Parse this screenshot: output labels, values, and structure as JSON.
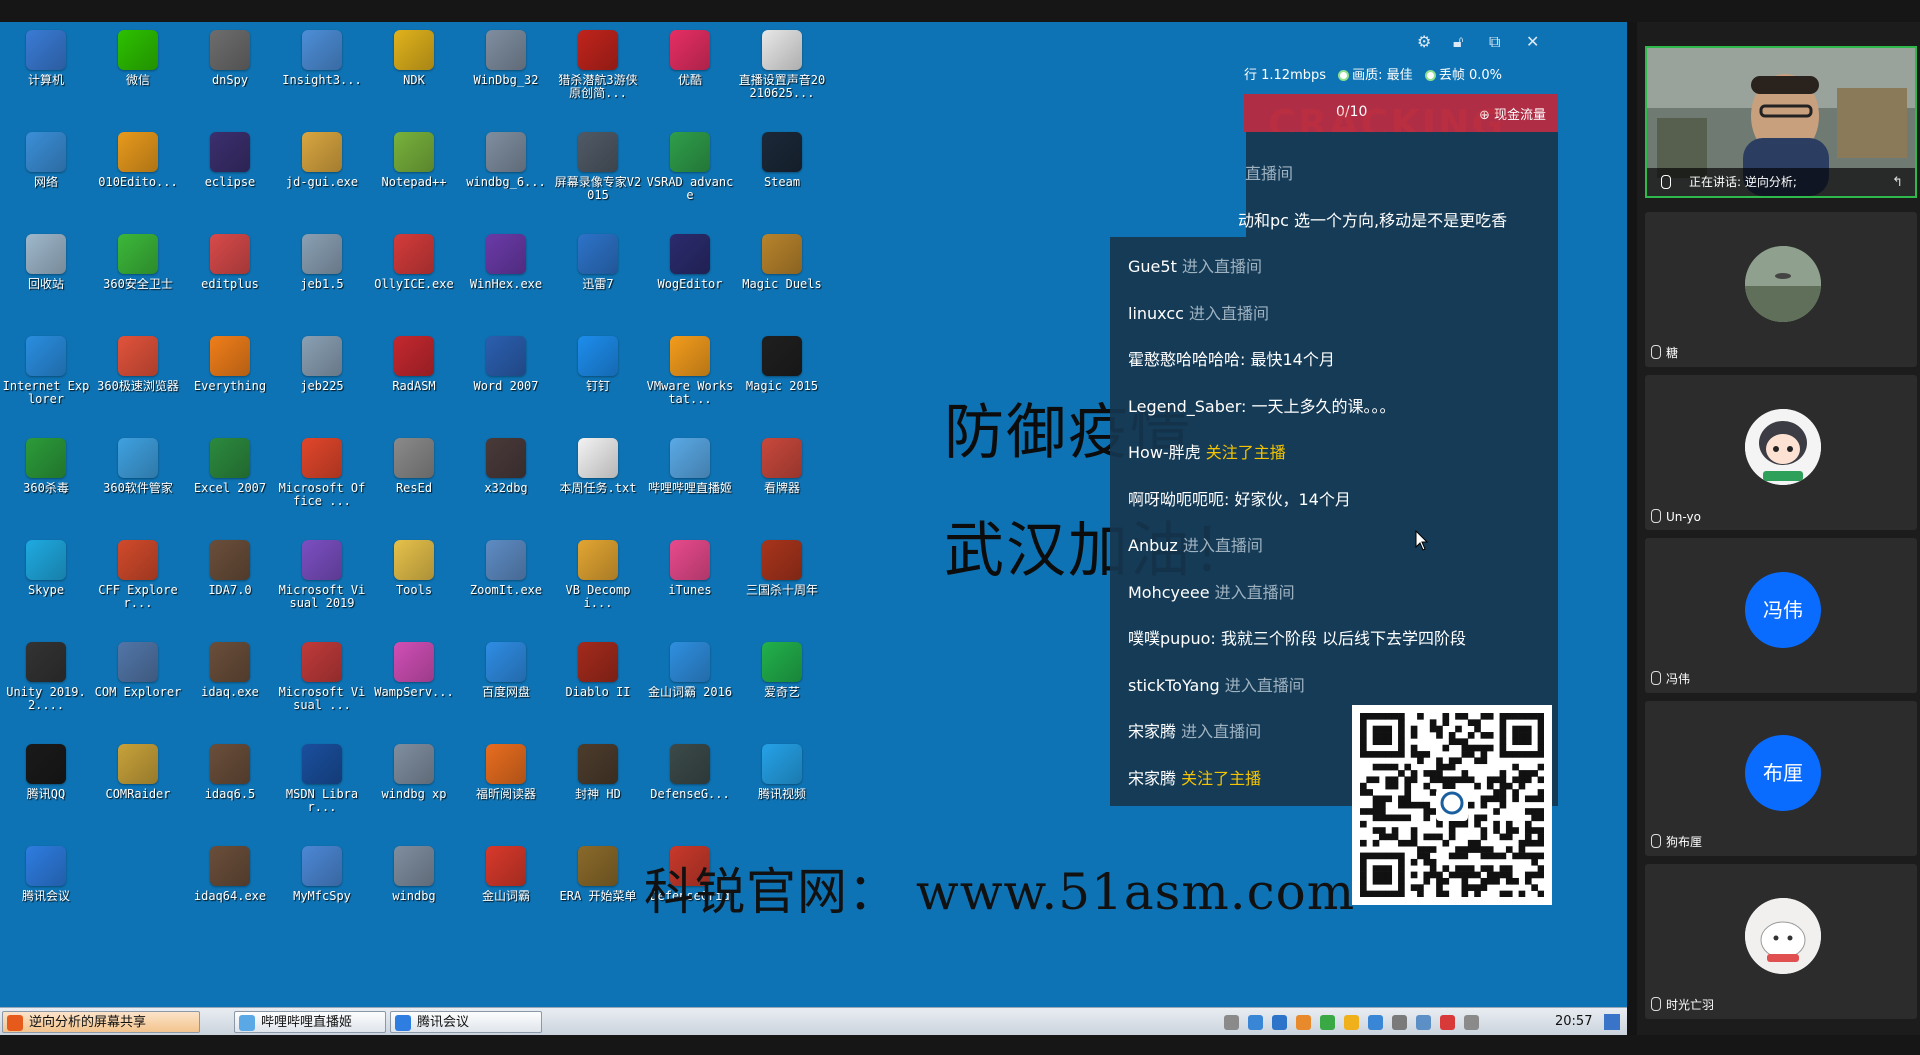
{
  "desktop": {
    "columns": [
      [
        {
          "label": "计算机",
          "icon": "computer-icon",
          "color": "#3a7bd5"
        },
        {
          "label": "网络",
          "icon": "network-icon",
          "color": "#3b8fd8"
        },
        {
          "label": "回收站",
          "icon": "recycle-bin-icon",
          "color": "#9fb8cc"
        },
        {
          "label": "Internet Explorer",
          "icon": "internet-explorer-icon",
          "color": "#2a8ee0"
        },
        {
          "label": "360杀毒",
          "icon": "360-antivirus-icon",
          "color": "#2c9b3a"
        },
        {
          "label": "Skype",
          "icon": "skype-icon",
          "color": "#1faae1"
        },
        {
          "label": "Unity 2019.2....",
          "icon": "unity-icon",
          "color": "#333333"
        },
        {
          "label": "腾讯QQ",
          "icon": "qq-icon",
          "color": "#1a1a1a"
        },
        {
          "label": "腾讯会议",
          "icon": "tencent-meeting-icon",
          "color": "#2e7de1"
        }
      ],
      [
        {
          "label": "微信",
          "icon": "wechat-icon",
          "color": "#2dc100"
        },
        {
          "label": "010Edito...",
          "icon": "010editor-icon",
          "color": "#e89a1c"
        },
        {
          "label": "360安全卫士",
          "icon": "360-safe-icon",
          "color": "#3cb83a"
        },
        {
          "label": "360极速浏览器",
          "icon": "360-browser-icon",
          "color": "#e2533b"
        },
        {
          "label": "360软件管家",
          "icon": "360-software-icon",
          "color": "#3fa1e0"
        },
        {
          "label": "CFF Explorer...",
          "icon": "cff-explorer-icon",
          "color": "#d14a2b"
        },
        {
          "label": "COM Explorer",
          "icon": "com-explorer-icon",
          "color": "#5276a8"
        },
        {
          "label": "COMRaider",
          "icon": "comraider-icon",
          "color": "#c8a23a"
        }
      ],
      [
        {
          "label": "dnSpy",
          "icon": "dnspy-icon",
          "color": "#6d6d6d"
        },
        {
          "label": "eclipse",
          "icon": "eclipse-icon",
          "color": "#3b2f6e"
        },
        {
          "label": "editplus",
          "icon": "editplus-icon",
          "color": "#d84a4a"
        },
        {
          "label": "Everything",
          "icon": "everything-icon",
          "color": "#f07e1a"
        },
        {
          "label": "Excel 2007",
          "icon": "excel-icon",
          "color": "#2c8a3e"
        },
        {
          "label": "IDA7.0",
          "icon": "ida-icon",
          "color": "#6a4e3a"
        },
        {
          "label": "idaq.exe",
          "icon": "idaq-icon",
          "color": "#6a4e3a"
        },
        {
          "label": "idaq6.5",
          "icon": "idaq65-icon",
          "color": "#6a4e3a"
        },
        {
          "label": "idaq64.exe",
          "icon": "idaq64-icon",
          "color": "#6a4e3a"
        }
      ],
      [
        {
          "label": "Insight3...",
          "icon": "insight-icon",
          "color": "#4d8ed8"
        },
        {
          "label": "jd-gui.exe",
          "icon": "jd-gui-icon",
          "color": "#d9a640"
        },
        {
          "label": "jeb1.5",
          "icon": "jeb-icon",
          "color": "#8aa0b4"
        },
        {
          "label": "jeb225",
          "icon": "jeb225-icon",
          "color": "#8aa0b4"
        },
        {
          "label": "Microsoft Office ...",
          "icon": "office-icon",
          "color": "#e1462b"
        },
        {
          "label": "Microsoft Visual 2019",
          "icon": "visual-studio-icon",
          "color": "#7b4fc2"
        },
        {
          "label": "Microsoft Visual ...",
          "icon": "visual-studio-old-icon",
          "color": "#c03a3a"
        },
        {
          "label": "MSDN Librar...",
          "icon": "msdn-icon",
          "color": "#1a4f9e"
        },
        {
          "label": "MyMfcSpy",
          "icon": "mymfcspy-icon",
          "color": "#4c88d6"
        }
      ],
      [
        {
          "label": "NDK",
          "icon": "ndk-icon",
          "color": "#e0b21c"
        },
        {
          "label": "Notepad++",
          "icon": "notepad-plus-icon",
          "color": "#78b23c"
        },
        {
          "label": "OllyICE.exe",
          "icon": "ollyice-icon",
          "color": "#d43b3b"
        },
        {
          "label": "RadASM",
          "icon": "radasm-icon",
          "color": "#c4282f"
        },
        {
          "label": "ResEd",
          "icon": "resed-icon",
          "color": "#8a8a8a"
        },
        {
          "label": "Tools",
          "icon": "folder-icon",
          "color": "#e6c14a"
        },
        {
          "label": "WampServ...",
          "icon": "wampserver-icon",
          "color": "#d04fb6"
        },
        {
          "label": "windbg xp",
          "icon": "windbg-xp-icon",
          "color": "#7f8ea0"
        },
        {
          "label": "windbg",
          "icon": "windbg-icon",
          "color": "#7f8ea0"
        }
      ],
      [
        {
          "label": "WinDbg_32",
          "icon": "windbg32-icon",
          "color": "#7f8ea0"
        },
        {
          "label": "windbg_6...",
          "icon": "windbg6-icon",
          "color": "#7f8ea0"
        },
        {
          "label": "WinHex.exe",
          "icon": "winhex-icon",
          "color": "#6a3aa8"
        },
        {
          "label": "Word 2007",
          "icon": "word-icon",
          "color": "#2b5fb0"
        },
        {
          "label": "x32dbg",
          "icon": "x32dbg-icon",
          "color": "#4a3a3a"
        },
        {
          "label": "ZoomIt.exe",
          "icon": "zoomit-icon",
          "color": "#5e8cc4"
        },
        {
          "label": "百度网盘",
          "icon": "baidu-netdisk-icon",
          "color": "#2f8de4"
        },
        {
          "label": "福昕阅读器",
          "icon": "foxit-reader-icon",
          "color": "#e86d1f"
        },
        {
          "label": "金山词霸",
          "icon": "kingsoft-dict-icon",
          "color": "#d8392b"
        }
      ],
      [
        {
          "label": "猎杀潜航3游侠原创简...",
          "icon": "silent-hunter-icon",
          "color": "#c0241c"
        },
        {
          "label": "屏幕录像专家V2015",
          "icon": "screen-recorder-icon",
          "color": "#505a66"
        },
        {
          "label": "迅雷7",
          "icon": "thunder-icon",
          "color": "#2d73c9"
        },
        {
          "label": "钉钉",
          "icon": "dingtalk-icon",
          "color": "#1d8ded"
        },
        {
          "label": "本周任务.txt",
          "icon": "text-file-icon",
          "color": "#f3f3f3"
        },
        {
          "label": "VB Decompi...",
          "icon": "vb-decompiler-icon",
          "color": "#e2a532"
        },
        {
          "label": "Diablo II",
          "icon": "diablo-icon",
          "color": "#a32a1c"
        },
        {
          "label": "封神 HD",
          "icon": "fengshen-icon",
          "color": "#4c3c2c"
        },
        {
          "label": "ERA 开始菜单",
          "icon": "era-icon",
          "color": "#8a6a2a"
        }
      ],
      [
        {
          "label": "优酷",
          "icon": "youku-icon",
          "color": "#e62e63"
        },
        {
          "label": "VSRAD advance",
          "icon": "vsrad-icon",
          "color": "#2f9e4a"
        },
        {
          "label": "WogEditor",
          "icon": "wogeditor-icon",
          "color": "#2b2b6e"
        },
        {
          "label": "VMware Workstat...",
          "icon": "vmware-icon",
          "color": "#f39c1c"
        },
        {
          "label": "哔哩哔哩直播姬",
          "icon": "bilibili-live-icon",
          "color": "#5aa9e6"
        },
        {
          "label": "iTunes",
          "icon": "itunes-icon",
          "color": "#e84a8c"
        },
        {
          "label": "金山词霸 2016",
          "icon": "kingsoft-dict-2016-icon",
          "color": "#2f8fe0"
        },
        {
          "label": "DefenseG...",
          "icon": "defensegrid-icon",
          "color": "#3c4a4a"
        },
        {
          "label": "DefenseGrid",
          "icon": "defensegrid2-icon",
          "color": "#c8392b"
        }
      ],
      [
        {
          "label": "直播设置声音20210625...",
          "icon": "audio-settings-icon",
          "color": "#e8e8e8"
        },
        {
          "label": "Steam",
          "icon": "steam-icon",
          "color": "#1b2838"
        },
        {
          "label": "Magic Duels",
          "icon": "magic-duels-icon",
          "color": "#b8842c"
        },
        {
          "label": "Magic 2015",
          "icon": "magic-2015-icon",
          "color": "#1f1f1f"
        },
        {
          "label": "看牌器",
          "icon": "card-viewer-icon",
          "color": "#c8483c"
        },
        {
          "label": "三国杀十周年",
          "icon": "sanguosha-icon",
          "color": "#a8341c"
        },
        {
          "label": "爱奇艺",
          "icon": "iqiyi-icon",
          "color": "#22b14c"
        },
        {
          "label": "腾讯视频",
          "icon": "tencent-video-icon",
          "color": "#25a2e8"
        }
      ]
    ]
  },
  "overlay": {
    "slogan_line1": "防御疫情",
    "slogan_line2": "武汉加油！",
    "site_url": "科锐官网： www.51asm.com",
    "watermark": "CRACKING"
  },
  "stream": {
    "toolbar_icons": [
      "gear-icon",
      "lock-icon",
      "popout-icon",
      "close-icon"
    ],
    "bitrate_text": "行 1.12mbps",
    "quality_text": "画质: 最佳",
    "drop_text": "丢帧 0.0%",
    "gift_count": "0/10",
    "gift_label": "⊕ 现金流量",
    "chat": [
      {
        "user": "",
        "action": "直播间",
        "highlight": false
      },
      {
        "user": "",
        "action": "动和pc 选一个方向,移动是不是更吃香",
        "highlight": false,
        "message": true
      },
      {
        "user": "Gue5t",
        "action": "进入直播间",
        "highlight": false
      },
      {
        "user": "linuxcc",
        "action": "进入直播间",
        "highlight": false
      },
      {
        "user": "霍憨憨哈哈哈哈:",
        "action": "最快14个月",
        "highlight": false,
        "message": true
      },
      {
        "user": "Legend_Saber:",
        "action": "一天上多久的课。。。",
        "highlight": false,
        "message": true
      },
      {
        "user": "How-胖虎",
        "action": "关注了主播",
        "highlight": true
      },
      {
        "user": "啊呀呦呃呃呃:",
        "action": "好家伙，14个月",
        "highlight": false,
        "message": true
      },
      {
        "user": "Anbuz",
        "action": "进入直播间",
        "highlight": false
      },
      {
        "user": "Mohcyeee",
        "action": "进入直播间",
        "highlight": false
      },
      {
        "user": "噗噗pupuo:",
        "action": "我就三个阶段 以后线下去学四阶段",
        "highlight": false,
        "message": true
      },
      {
        "user": "stickToYang",
        "action": "进入直播间",
        "highlight": false
      },
      {
        "user": "宋家腾",
        "action": "进入直播间",
        "highlight": false
      },
      {
        "user": "宋家腾",
        "action": "关注了主播",
        "highlight": true
      }
    ]
  },
  "taskbar": {
    "buttons": [
      {
        "label": "逆向分析的屏幕共享",
        "icon": "screen-share-icon",
        "color": "#e65a1c"
      },
      {
        "label": "哔哩哔哩直播姬",
        "icon": "bilibili-live-icon",
        "color": "#5aa9e6"
      },
      {
        "label": "腾讯会议",
        "icon": "tencent-meeting-icon",
        "color": "#2e7de1"
      }
    ],
    "tray_colors": [
      "#8a8a8a",
      "#3a86d6",
      "#2d73c9",
      "#e88a2c",
      "#3aa845",
      "#f0b01c",
      "#3a86d6",
      "#7a7a7a",
      "#5d8fc7",
      "#d83a3a",
      "#8a8a8a"
    ],
    "clock": "20:57"
  },
  "meeting": {
    "speaker_caption": "正在讲话: 逆向分析;",
    "participants": [
      {
        "name": "糖",
        "avatar_type": "photo-dome",
        "color": "#6a8a6a",
        "initials": ""
      },
      {
        "name": "Un-yo",
        "avatar_type": "cartoon",
        "color": "#f2f2f2",
        "initials": ""
      },
      {
        "name": "冯伟",
        "avatar_type": "initials",
        "color": "#0a6cff",
        "initials": "冯伟"
      },
      {
        "name": "狗布厘",
        "avatar_type": "initials",
        "color": "#0a6cff",
        "initials": "布厘"
      },
      {
        "name": "时光亡羽",
        "avatar_type": "cartoon-cat",
        "color": "#f0eeee",
        "initials": ""
      }
    ]
  }
}
